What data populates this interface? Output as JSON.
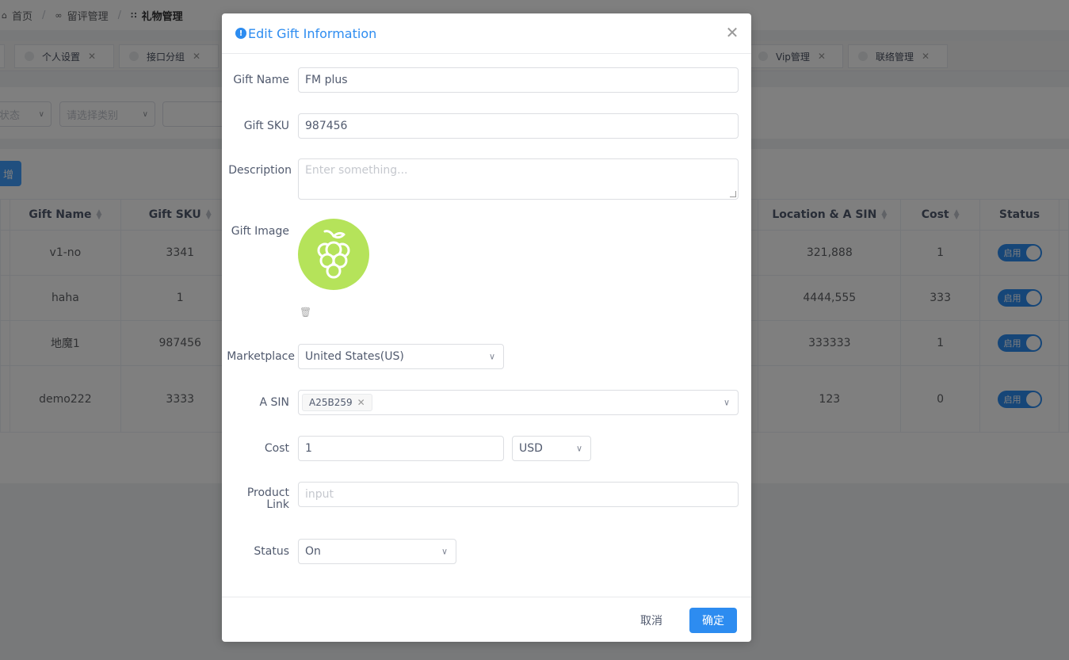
{
  "breadcrumb": {
    "home": "首页",
    "second": "留评管理",
    "current": "礼物管理"
  },
  "tabs": [
    {
      "label": "个人设置"
    },
    {
      "label": "接口分组"
    },
    {
      "label": "Vip管理"
    },
    {
      "label": "联络管理"
    }
  ],
  "filters": {
    "status_placeholder": "状态",
    "category_placeholder": "请选择类别"
  },
  "toolbar": {
    "add_label": "增"
  },
  "table": {
    "headers": {
      "gift_name": "Gift Name",
      "gift_sku": "Gift SKU",
      "location": "Location & A SIN",
      "cost": "Cost",
      "status": "Status"
    },
    "rows": [
      {
        "name": "v1-no",
        "sku": "3341",
        "location": "321,888",
        "cost": "1",
        "status": "启用"
      },
      {
        "name": "haha",
        "sku": "1",
        "location": "4444,555",
        "cost": "333",
        "status": "启用"
      },
      {
        "name": "地魔1",
        "sku": "987456",
        "location": "333333",
        "cost": "1",
        "status": "启用"
      },
      {
        "name": "demo222",
        "sku": "3333",
        "location": "123",
        "cost": "0",
        "status": "启用"
      }
    ]
  },
  "modal": {
    "title": "Edit Gift Information",
    "fields": {
      "gift_name_label": "Gift Name",
      "gift_name_value": "FM plus",
      "gift_sku_label": "Gift SKU",
      "gift_sku_value": "987456",
      "description_label": "Description",
      "description_placeholder": "Enter something...",
      "gift_image_label": "Gift Image",
      "marketplace_label": "Marketplace",
      "marketplace_value": "United States(US)",
      "asin_label": "A SIN",
      "asin_tag": "A25B259",
      "cost_label": "Cost",
      "cost_value": "1",
      "currency_value": "USD",
      "product_link_label_1": "Product",
      "product_link_label_2": "Link",
      "product_link_placeholder": "input",
      "status_label": "Status",
      "status_value": "On"
    },
    "buttons": {
      "cancel": "取消",
      "ok": "确定"
    }
  },
  "colors": {
    "primary": "#2d8cf0",
    "image_bg": "#b5e35a"
  }
}
